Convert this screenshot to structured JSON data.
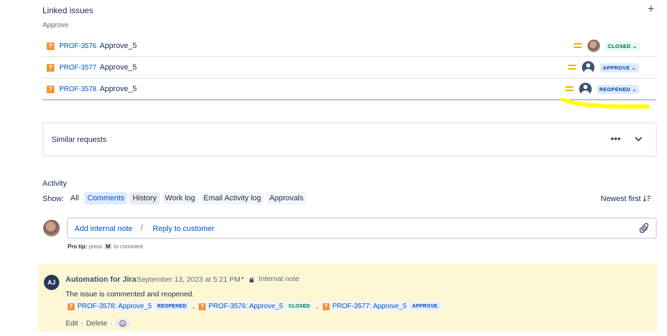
{
  "linked_issues": {
    "title": "Linked issues",
    "add_icon": "plus-icon",
    "link_type": "Approve",
    "rows": [
      {
        "key": "PROF-3576",
        "summary": "Approve_5",
        "priority": "medium",
        "assignee": "photo",
        "status": "CLOSED",
        "status_color": "#006644"
      },
      {
        "key": "PROF-3577",
        "summary": "Approve_5",
        "priority": "medium",
        "assignee": "default-user",
        "status": "APPROVE",
        "status_color": "#0747a6"
      },
      {
        "key": "PROF-3578",
        "summary": "Approve_5",
        "priority": "medium",
        "assignee": "default-user",
        "status": "REOPENED",
        "status_color": "#0747a6"
      }
    ],
    "annotation_color": "#ffff00"
  },
  "similar": {
    "label": "Similar requests",
    "more_icon": "•••"
  },
  "activity": {
    "title": "Activity",
    "show_label": "Show:",
    "filters": [
      "All",
      "Comments",
      "History",
      "Work log",
      "Email Activity log",
      "Approvals"
    ],
    "selected": "History",
    "sort_label": "Newest first"
  },
  "composer": {
    "add_note": "Add internal note",
    "divider": "/",
    "reply": "Reply to customer",
    "protip_prefix": "Pro tip:",
    "protip_press": "press",
    "protip_key": "M",
    "protip_suffix": "to comment"
  },
  "comment": {
    "avatar_initials": "AJ",
    "author": "Automation for Jira",
    "date": "September 13, 2023 at 5:21 PM",
    "bullet": "•",
    "visibility": "Internal note",
    "body": "The issue is commented and reopened.",
    "links": [
      {
        "text": "PROF-3578: Approve_5",
        "status": "REOPENED"
      },
      {
        "text": "PROF-3576: Approve_5",
        "status": "CLOSED"
      },
      {
        "text": "PROF-3577: Approve_5",
        "status": "APPROVE"
      }
    ],
    "separator": ",",
    "edit": "Edit",
    "delete": "Delete",
    "dot": "·",
    "background": "#fdf7d4"
  }
}
